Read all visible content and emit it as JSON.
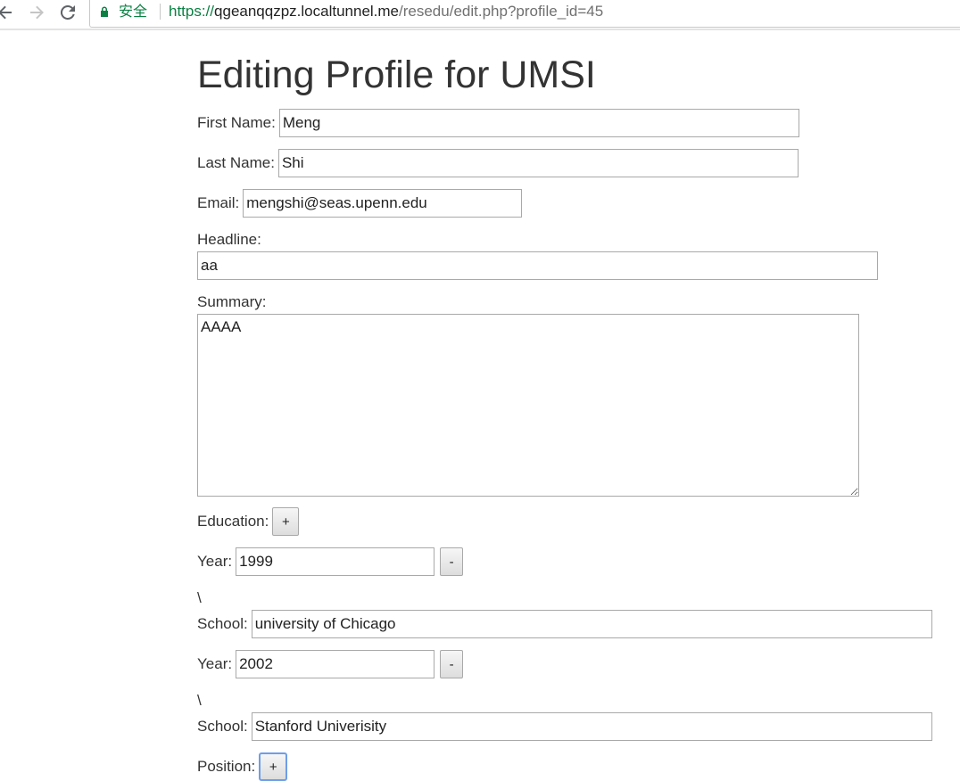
{
  "browser": {
    "secure_label": "安全",
    "url_scheme": "https://",
    "url_host": "qgeanqqzpz.localtunnel.me",
    "url_path": "/resedu/edit.php?profile_id=45",
    "secure_color": "#0b8043"
  },
  "page": {
    "title": "Editing Profile for UMSI"
  },
  "form": {
    "first_name_label": "First Name:",
    "first_name_value": "Meng",
    "last_name_label": "Last Name:",
    "last_name_value": "Shi",
    "email_label": "Email:",
    "email_value": "mengshi@seas.upenn.edu",
    "headline_label": "Headline:",
    "headline_value": "aa",
    "summary_label": "Summary:",
    "summary_value": "AAAA",
    "education_label": "Education:",
    "add_label": "+",
    "education": [
      {
        "year_label": "Year:",
        "year_value": "1999",
        "remove_label": "-",
        "separator": "\\",
        "school_label": "School:",
        "school_value": "university of Chicago"
      },
      {
        "year_label": "Year:",
        "year_value": "2002",
        "remove_label": "-",
        "separator": "\\",
        "school_label": "School:",
        "school_value": "Stanford Univerisity"
      }
    ],
    "position_label": "Position:",
    "position_add_label": "+"
  }
}
